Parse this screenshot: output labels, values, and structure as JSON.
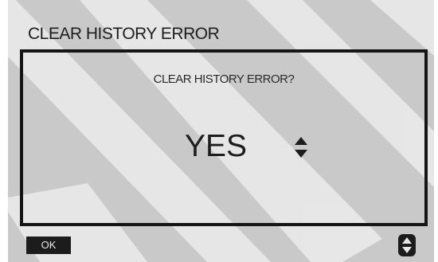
{
  "screen": {
    "title": "CLEAR HISTORY ERROR",
    "background_color": "#c9c9c9",
    "text_color": "#1e1e1e"
  },
  "dialog": {
    "question": "CLEAR HISTORY ERROR?",
    "selected_value": "YES",
    "selector_icon": "up-down-arrows-icon"
  },
  "footer": {
    "ok_label": "OK",
    "scroll_icon": "up-down-scroll-icon"
  }
}
